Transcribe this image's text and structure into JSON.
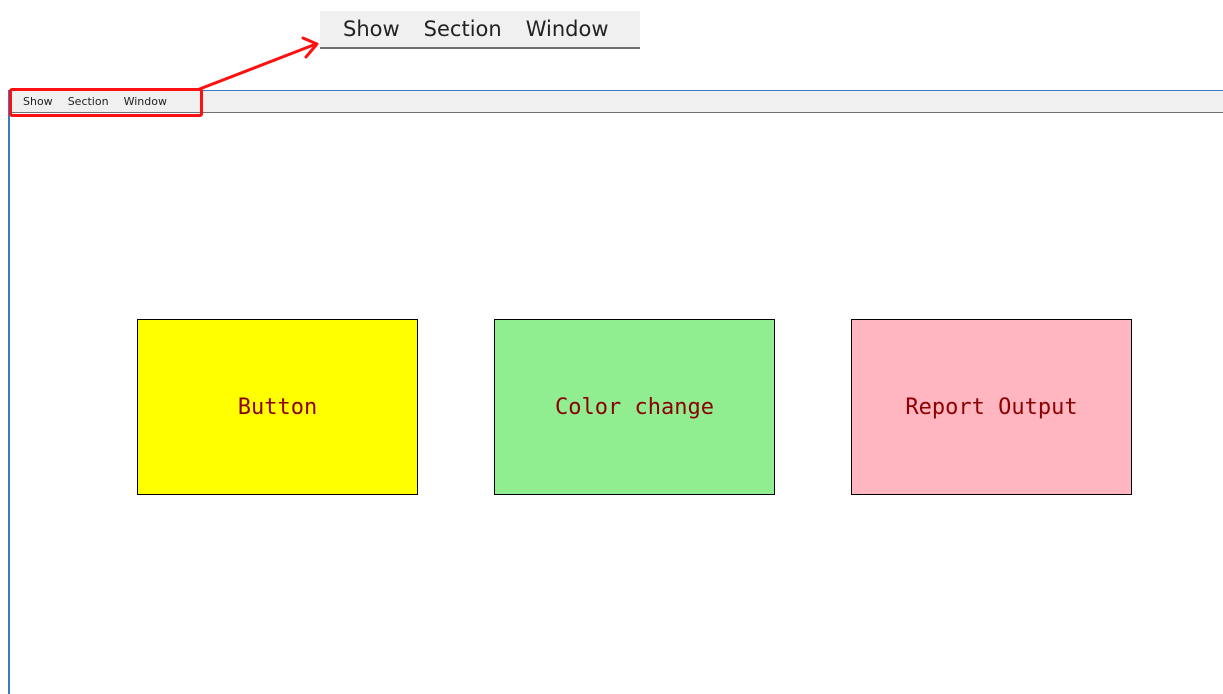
{
  "callout": {
    "menu_items": [
      "Show",
      "Section",
      "Window"
    ]
  },
  "window": {
    "menu_items": [
      "Show",
      "Section",
      "Window"
    ]
  },
  "tiles": [
    {
      "label": "Button",
      "color": "#ffff00"
    },
    {
      "label": "Color change",
      "color": "#90ee90"
    },
    {
      "label": "Report Output",
      "color": "#ffb6c1"
    }
  ],
  "colors": {
    "tile_text": "#8b0000",
    "highlight": "#ff1010",
    "window_border": "#3c78c8",
    "menubar_bg": "#f0f0f0"
  }
}
